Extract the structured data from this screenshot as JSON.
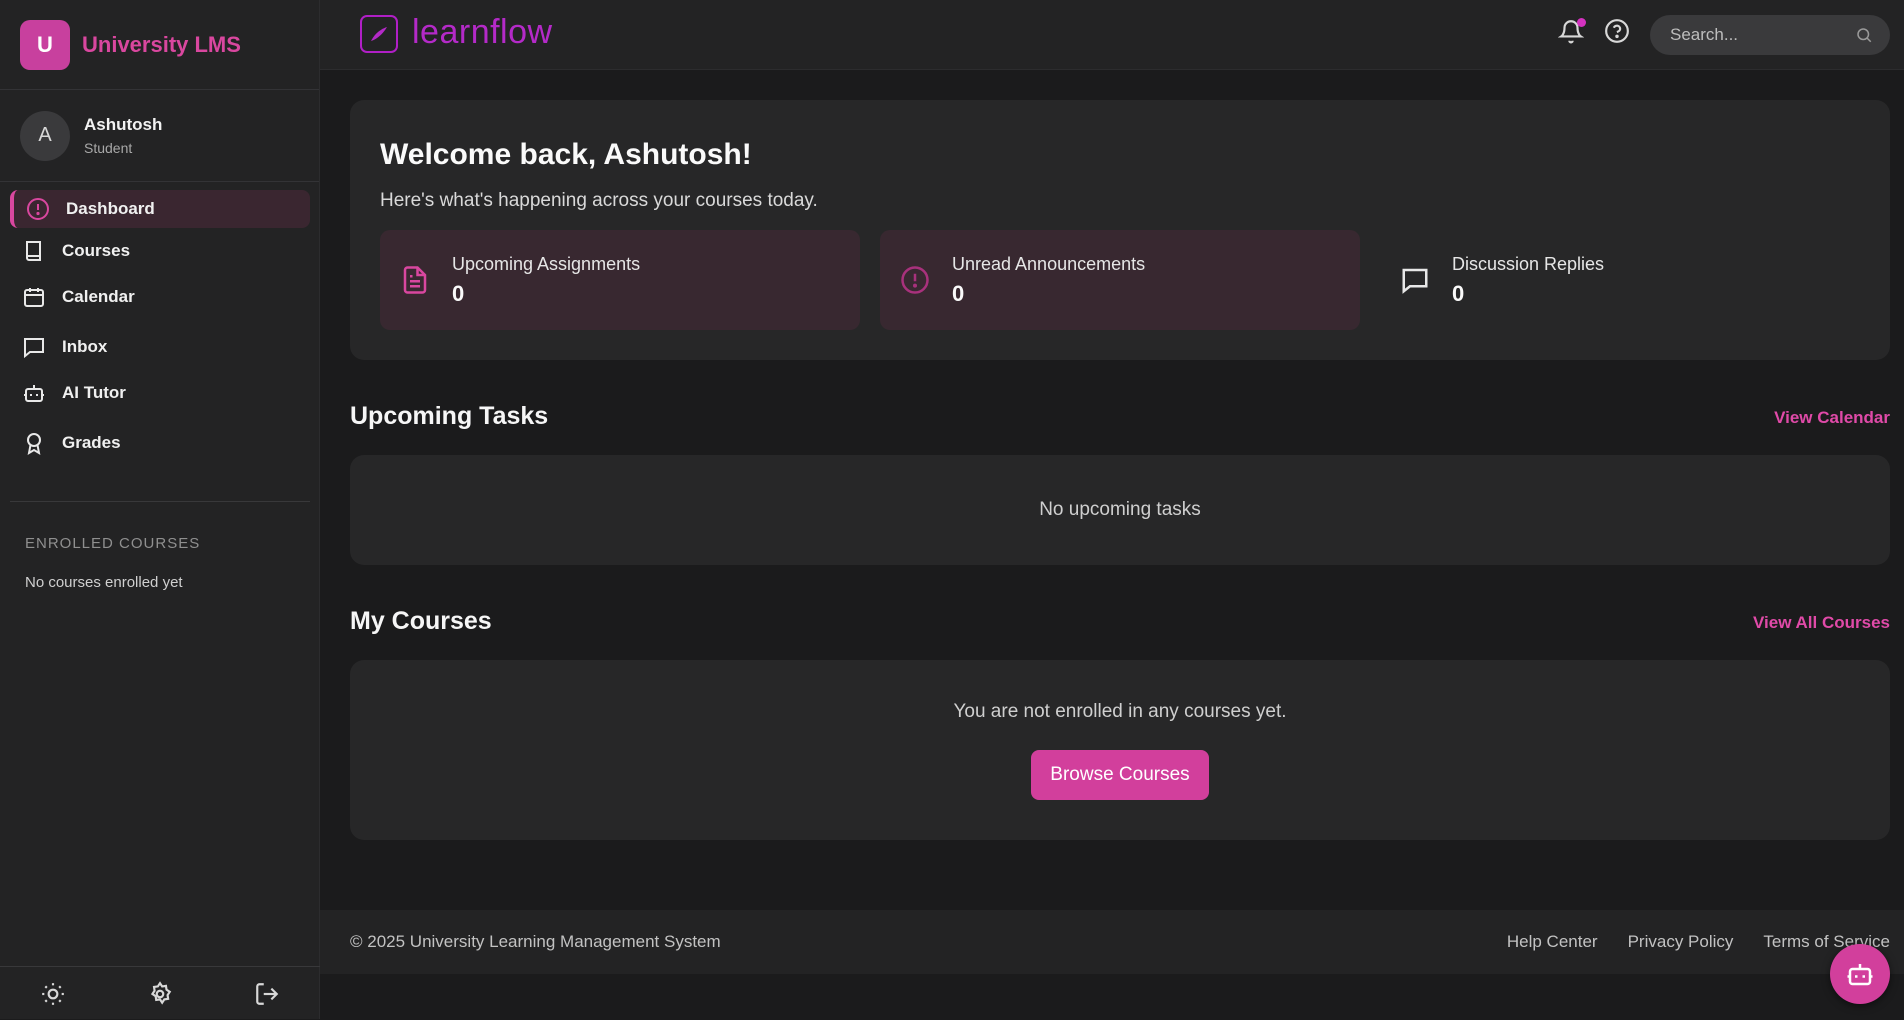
{
  "brand": {
    "logo_letter": "U",
    "name": "University LMS"
  },
  "user": {
    "initial": "A",
    "name": "Ashutosh",
    "role": "Student"
  },
  "nav": {
    "items": [
      {
        "label": "Dashboard",
        "icon": "alert-circle-icon",
        "active": true
      },
      {
        "label": "Courses",
        "icon": "book-icon"
      },
      {
        "label": "Calendar",
        "icon": "calendar-icon"
      },
      {
        "label": "Inbox",
        "icon": "message-square-icon"
      },
      {
        "label": "AI Tutor",
        "icon": "bot-icon"
      },
      {
        "label": "Grades",
        "icon": "award-icon"
      }
    ]
  },
  "enrolled": {
    "title": "ENROLLED COURSES",
    "empty": "No courses enrolled yet"
  },
  "topbar": {
    "app_name": "learnflow",
    "search_placeholder": "Search..."
  },
  "welcome": {
    "title": "Welcome back, Ashutosh!",
    "subtitle": "Here's what's happening across your courses today.",
    "stats": [
      {
        "label": "Upcoming Assignments",
        "value": "0",
        "icon": "file-text-icon"
      },
      {
        "label": "Unread Announcements",
        "value": "0",
        "icon": "alert-circle-icon"
      },
      {
        "label": "Discussion Replies",
        "value": "0",
        "icon": "message-square-icon"
      }
    ]
  },
  "tasks": {
    "title": "Upcoming Tasks",
    "link": "View Calendar",
    "empty": "No upcoming tasks"
  },
  "courses": {
    "title": "My Courses",
    "link": "View All Courses",
    "empty": "You are not enrolled in any courses yet.",
    "button": "Browse Courses"
  },
  "footer": {
    "copyright": "© 2025 University Learning Management System",
    "links": [
      "Help Center",
      "Privacy Policy",
      "Terms of Service"
    ]
  },
  "colors": {
    "accent": "#d23f9c",
    "brand_text": "#d9479f",
    "logo_purple": "#b42ac8",
    "background": "#1b1b1c",
    "panel": "#272728"
  }
}
